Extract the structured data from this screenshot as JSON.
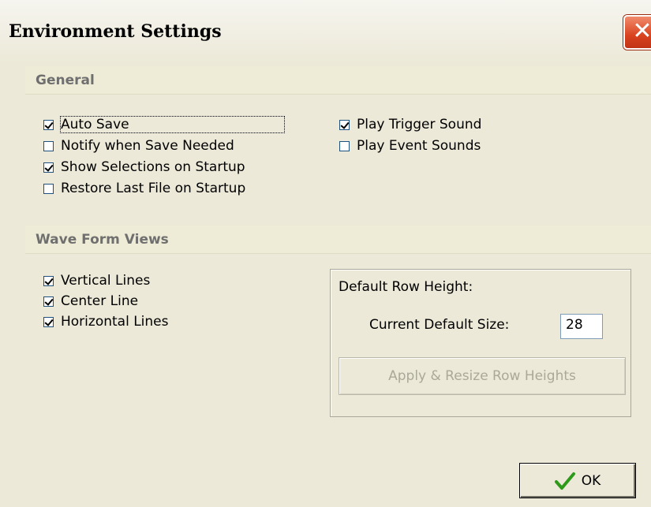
{
  "window": {
    "title": "Environment Settings",
    "close_glyph": "✕"
  },
  "general": {
    "header": "General",
    "options": [
      {
        "label": "Auto Save",
        "checked": true
      },
      {
        "label": "Notify when Save Needed",
        "checked": false
      },
      {
        "label": "Show Selections on Startup",
        "checked": true
      },
      {
        "label": "Restore Last File on Startup",
        "checked": false
      },
      {
        "label": "Play Trigger Sound",
        "checked": true
      },
      {
        "label": "Play Event Sounds",
        "checked": false
      }
    ]
  },
  "waveform": {
    "header": "Wave Form Views",
    "options": [
      {
        "label": "Vertical Lines",
        "checked": true
      },
      {
        "label": "Center Line",
        "checked": true
      },
      {
        "label": "Horizontal Lines",
        "checked": true
      }
    ],
    "row_height": {
      "title": "Default Row Height:",
      "size_label": "Current Default Size:",
      "size_value": "28",
      "apply_button": "Apply & Resize Row Heights"
    }
  },
  "footer": {
    "ok_label": "OK"
  },
  "colors": {
    "background": "#ece9d8",
    "section_header": "#eeecd6",
    "close_button": "#d9431f",
    "ok_check": "#2e9a1a"
  }
}
